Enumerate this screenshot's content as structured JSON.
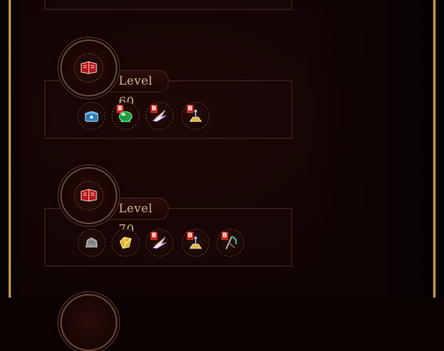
{
  "tiers": [
    {
      "level_label": "Level 60",
      "emblem": "red-book-icon",
      "rewards": [
        {
          "icon": "blue-chest-icon",
          "bound": false,
          "bound_mark": ""
        },
        {
          "icon": "green-orb-icon",
          "bound": true,
          "bound_mark": "B"
        },
        {
          "icon": "feather-wing-icon",
          "bound": true,
          "bound_mark": "B"
        },
        {
          "icon": "gold-pedestal-icon",
          "bound": true,
          "bound_mark": "B"
        }
      ]
    },
    {
      "level_label": "Level 70",
      "emblem": "red-book-icon",
      "rewards": [
        {
          "icon": "stone-ore-icon",
          "bound": false,
          "bound_mark": ""
        },
        {
          "icon": "gold-crystal-icon",
          "bound": false,
          "bound_mark": ""
        },
        {
          "icon": "feather-wing-icon",
          "bound": true,
          "bound_mark": "B"
        },
        {
          "icon": "gold-pedestal-icon",
          "bound": true,
          "bound_mark": "B"
        },
        {
          "icon": "dark-scythe-icon",
          "bound": true,
          "bound_mark": "B"
        }
      ]
    }
  ],
  "colors": {
    "background": "#140504",
    "gold_border": "#d8b25a",
    "label_text": "#d7b486",
    "bound_badge": "#c8281c",
    "panel_border": "#4a2a20"
  }
}
